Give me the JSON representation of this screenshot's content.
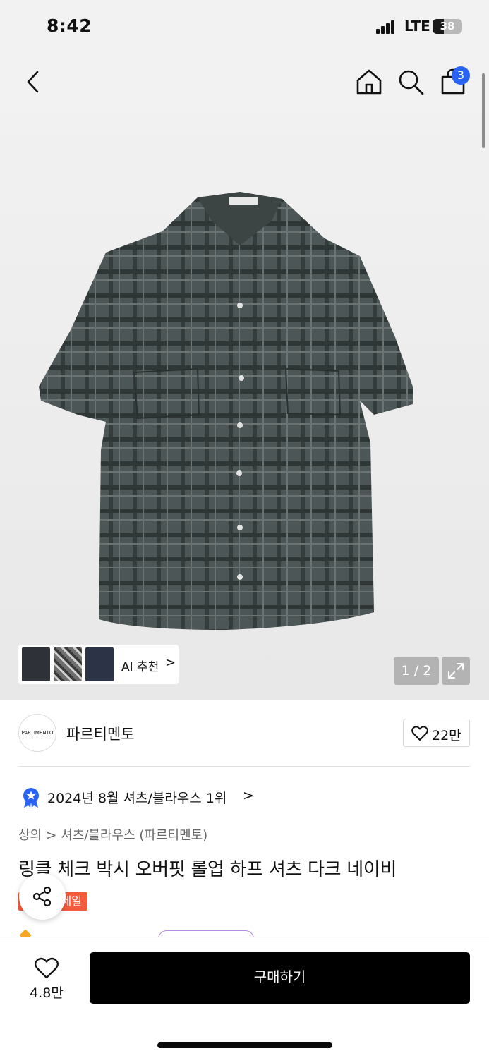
{
  "status_bar": {
    "time": "8:42",
    "network": "LTE",
    "battery": "38",
    "battery_level_pct": 38
  },
  "nav": {
    "cart_count": "3"
  },
  "gallery": {
    "rec_label": "AI 추천",
    "rec_chevron": ">",
    "pager": "1 / 2"
  },
  "brand": {
    "logo_text": "PARTIMENTO",
    "name": "파르티멘토",
    "likes": "22만"
  },
  "ranking": {
    "text": "2024년 8월 셔츠/블라우스 1위",
    "chevron": ">"
  },
  "breadcrumb": {
    "level1": "상의",
    "sep": ">",
    "level2": "셔츠/블라우스 (파르티멘토)"
  },
  "product": {
    "title": "링클 체크 박시 오버핏 롤업 하프 셔츠 다크 네이비",
    "tag": "세일"
  },
  "bottom_bar": {
    "wish_count": "4.8만",
    "buy_label": "구매하기"
  },
  "colors": {
    "accent_blue": "#2a63f3",
    "sale_red": "#f25b3c",
    "buy_bg": "#000000"
  }
}
